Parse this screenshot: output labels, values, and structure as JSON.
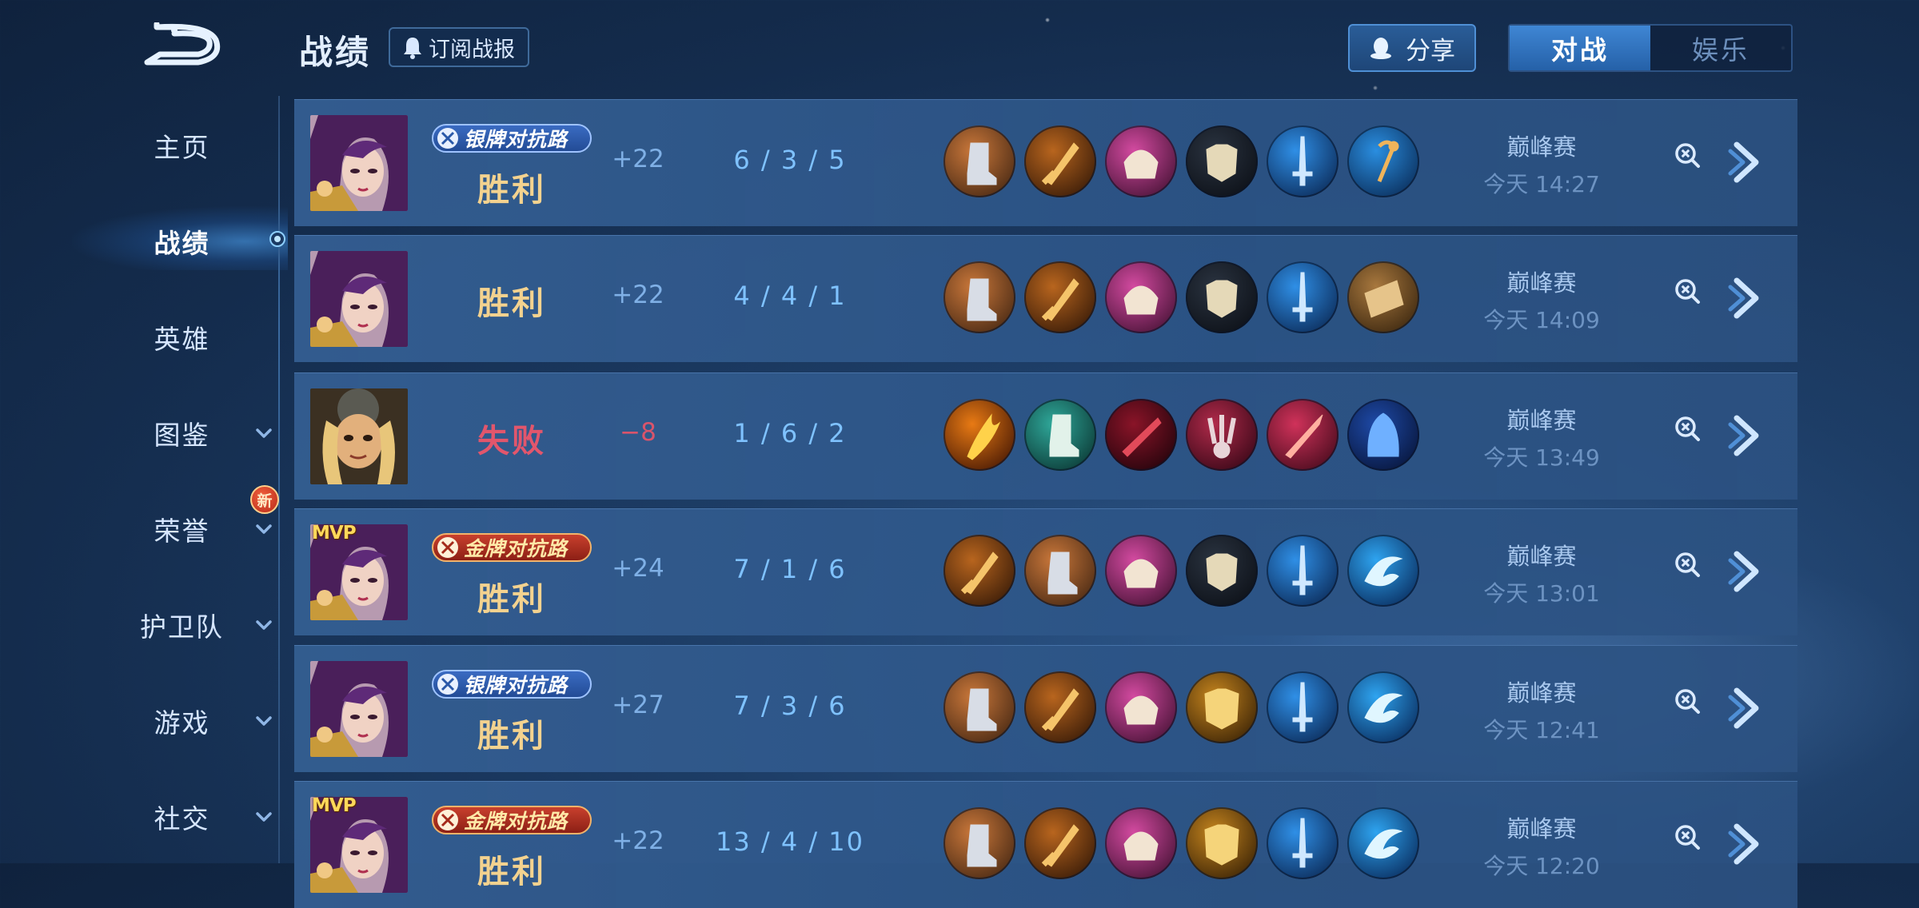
{
  "header": {
    "title": "战绩",
    "subscribe_label": "订阅战报",
    "share_label": "分享",
    "tabs": [
      {
        "label": "对战",
        "active": true
      },
      {
        "label": "娱乐",
        "active": false
      }
    ]
  },
  "sidebar": {
    "items": [
      {
        "label": "主页",
        "dropdown": false
      },
      {
        "label": "战绩",
        "dropdown": false,
        "active": true
      },
      {
        "label": "英雄",
        "dropdown": false
      },
      {
        "label": "图鉴",
        "dropdown": true
      },
      {
        "label": "荣誉",
        "dropdown": true,
        "badge": "新"
      },
      {
        "label": "护卫队",
        "dropdown": true
      },
      {
        "label": "游戏",
        "dropdown": true
      },
      {
        "label": "社交",
        "dropdown": true
      }
    ]
  },
  "matches": [
    {
      "mvp": false,
      "badge": {
        "type": "silver",
        "label": "银牌对抗路"
      },
      "result": "胜利",
      "outcome": "win",
      "delta": "+22",
      "kda": "6 / 3 / 5",
      "mode": "巅峰赛",
      "time": "今天 14:27",
      "items": [
        "boots-icon",
        "blade-icon",
        "helmet-icon",
        "armor-icon",
        "sword-icon",
        "staff-icon"
      ]
    },
    {
      "mvp": false,
      "badge": null,
      "result": "胜利",
      "outcome": "win",
      "delta": "+22",
      "kda": "4 / 4 / 1",
      "mode": "巅峰赛",
      "time": "今天 14:09",
      "items": [
        "boots-icon",
        "blade-icon",
        "helmet-icon",
        "armor-icon",
        "sword-icon",
        "shield-icon"
      ]
    },
    {
      "mvp": false,
      "badge": null,
      "result": "失败",
      "outcome": "lose",
      "delta": "−8",
      "kda": "1 / 6 / 2",
      "mode": "巅峰赛",
      "time": "今天 13:49",
      "items": [
        "flame-blade-icon",
        "jade-boots-icon",
        "dark-blade-icon",
        "claw-icon",
        "spear-icon",
        "cloak-icon"
      ]
    },
    {
      "mvp": true,
      "mvp_label": "MVP",
      "badge": {
        "type": "gold",
        "label": "金牌对抗路"
      },
      "result": "胜利",
      "outcome": "win",
      "delta": "+24",
      "kda": "7 / 1 / 6",
      "mode": "巅峰赛",
      "time": "今天 13:01",
      "items": [
        "blade-icon",
        "boots-icon",
        "helmet-icon",
        "armor-icon",
        "sword-icon",
        "wave-icon"
      ]
    },
    {
      "mvp": false,
      "badge": {
        "type": "silver",
        "label": "银牌对抗路"
      },
      "result": "胜利",
      "outcome": "win",
      "delta": "+27",
      "kda": "7 / 3 / 6",
      "mode": "巅峰赛",
      "time": "今天 12:41",
      "items": [
        "boots-icon",
        "blade-icon",
        "helmet-icon",
        "gold-armor-icon",
        "sword-icon",
        "wave-icon"
      ]
    },
    {
      "mvp": true,
      "mvp_label": "MVP",
      "badge": {
        "type": "gold",
        "label": "金牌对抗路"
      },
      "result": "胜利",
      "outcome": "win",
      "delta": "+22",
      "kda": "13 / 4 / 10",
      "mode": "巅峰赛",
      "time": "今天 12:20",
      "items": [
        "boots-icon",
        "blade-icon",
        "helmet-icon",
        "gold-armor-icon",
        "sword-icon",
        "wave-icon"
      ]
    }
  ],
  "colors": {
    "win": "#f3d28f",
    "lose": "#e2566c",
    "kda": "#7fc2ff",
    "tab_active": "#3f86d4"
  }
}
